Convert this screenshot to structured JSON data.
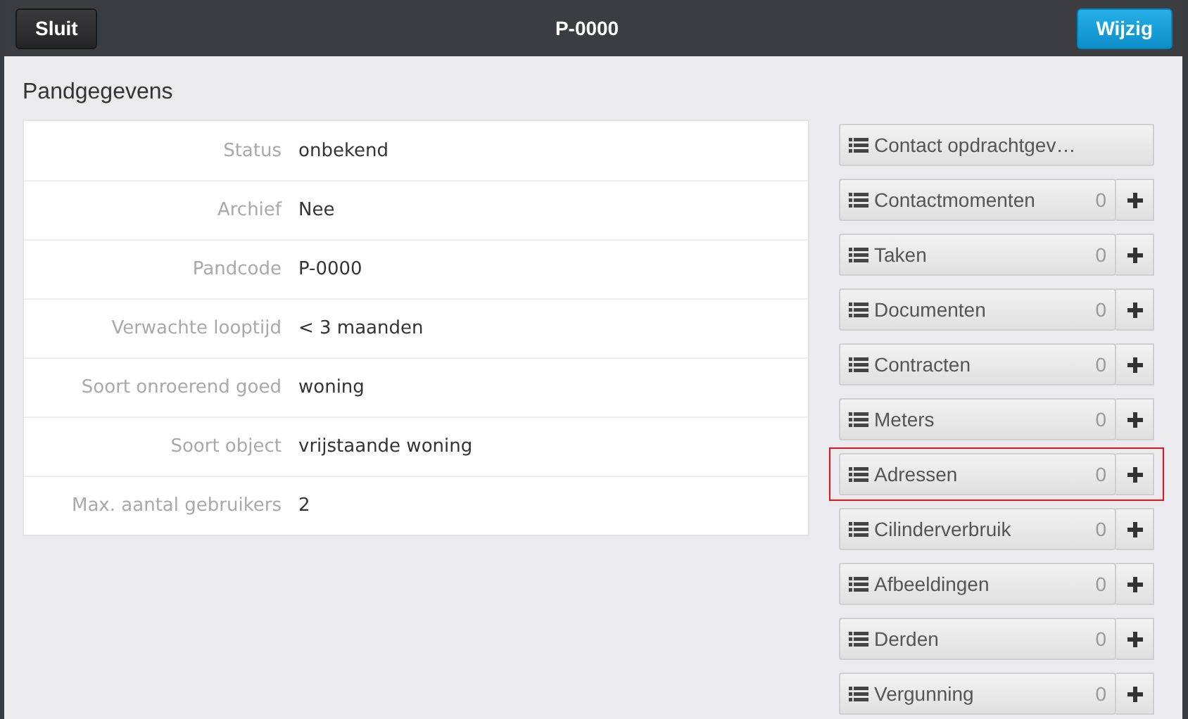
{
  "header": {
    "close_button": "Sluit",
    "title": "P-0000",
    "edit_button": "Wijzig"
  },
  "section_title": "Pandgegevens",
  "fields": [
    {
      "label": "Status",
      "value": "onbekend"
    },
    {
      "label": "Archief",
      "value": "Nee"
    },
    {
      "label": "Pandcode",
      "value": "P-0000"
    },
    {
      "label": "Verwachte looptijd",
      "value": "< 3 maanden"
    },
    {
      "label": "Soort onroerend goed",
      "value": "woning"
    },
    {
      "label": "Soort object",
      "value": "vrijstaande woning"
    },
    {
      "label": "Max. aantal gebruikers",
      "value": "2"
    }
  ],
  "links": [
    {
      "kind": "link",
      "label": "Contact opdrachtgev…",
      "highlighted": false
    },
    {
      "kind": "counter",
      "label": "Contactmomenten",
      "count": "0",
      "highlighted": false
    },
    {
      "kind": "counter",
      "label": "Taken",
      "count": "0",
      "highlighted": false
    },
    {
      "kind": "counter",
      "label": "Documenten",
      "count": "0",
      "highlighted": false
    },
    {
      "kind": "counter",
      "label": "Contracten",
      "count": "0",
      "highlighted": false
    },
    {
      "kind": "counter",
      "label": "Meters",
      "count": "0",
      "highlighted": false
    },
    {
      "kind": "counter",
      "label": "Adressen",
      "count": "0",
      "highlighted": true
    },
    {
      "kind": "counter",
      "label": "Cilinderverbruik",
      "count": "0",
      "highlighted": false
    },
    {
      "kind": "counter",
      "label": "Afbeeldingen",
      "count": "0",
      "highlighted": false
    },
    {
      "kind": "counter",
      "label": "Derden",
      "count": "0",
      "highlighted": false
    },
    {
      "kind": "counter",
      "label": "Vergunning",
      "count": "0",
      "highlighted": false
    }
  ]
}
